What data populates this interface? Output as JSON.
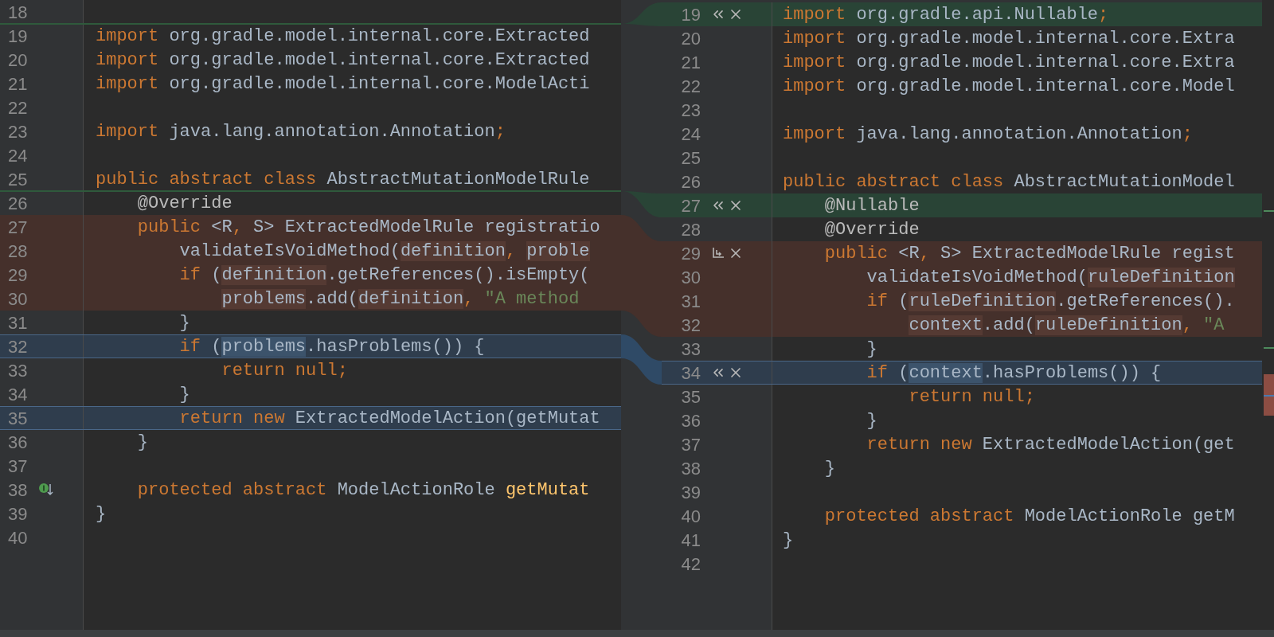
{
  "left": {
    "rows": [
      {
        "num": "18",
        "kind": "none"
      },
      {
        "num": "19",
        "kind": "none",
        "tokens": [
          {
            "text": "import",
            "kind": "kw"
          },
          {
            "text": " org.gradle.model.internal.core.Extracted",
            "kind": "plain"
          }
        ]
      },
      {
        "num": "20",
        "kind": "none",
        "tokens": [
          {
            "text": "import",
            "kind": "kw"
          },
          {
            "text": " org.gradle.model.internal.core.Extracted",
            "kind": "plain"
          }
        ]
      },
      {
        "num": "21",
        "kind": "none",
        "tokens": [
          {
            "text": "import",
            "kind": "kw"
          },
          {
            "text": " org.gradle.model.internal.core.ModelActi",
            "kind": "plain"
          }
        ]
      },
      {
        "num": "22",
        "kind": "none"
      },
      {
        "num": "23",
        "kind": "none",
        "tokens": [
          {
            "text": "import",
            "kind": "kw"
          },
          {
            "text": " java.lang.annotation.Annotation",
            "kind": "plain"
          },
          {
            "text": ";",
            "kind": "kw"
          }
        ]
      },
      {
        "num": "24",
        "kind": "none"
      },
      {
        "num": "25",
        "kind": "none",
        "tokens": [
          {
            "text": "public abstract class",
            "kind": "kw"
          },
          {
            "text": " AbstractMutationModelRule",
            "kind": "plain"
          }
        ]
      },
      {
        "num": "26",
        "kind": "none",
        "tokens": [
          {
            "text": "    @Override",
            "kind": "ann"
          }
        ]
      },
      {
        "num": "27",
        "kind": "removed",
        "tokens": [
          {
            "text": "    public",
            "kind": "kw"
          },
          {
            "text": " <R",
            "kind": "plain"
          },
          {
            "text": ",",
            "kind": "kw"
          },
          {
            "text": " S> ExtractedModelRule registratio",
            "kind": "plain"
          }
        ]
      },
      {
        "num": "28",
        "kind": "removed",
        "tokens": [
          {
            "text": "        validateIsVoidMethod(",
            "kind": "plain"
          },
          {
            "text": "definition",
            "kind": "plain",
            "hl": true
          },
          {
            "text": ", ",
            "kind": "kw"
          },
          {
            "text": "proble",
            "kind": "plain",
            "hl": true
          }
        ]
      },
      {
        "num": "29",
        "kind": "removed",
        "tokens": [
          {
            "text": "        if",
            "kind": "kw"
          },
          {
            "text": " (",
            "kind": "plain"
          },
          {
            "text": "definition",
            "kind": "plain",
            "hl": true
          },
          {
            "text": ".getReferences().isEmpty(",
            "kind": "plain"
          }
        ]
      },
      {
        "num": "30",
        "kind": "removed",
        "tokens": [
          {
            "text": "            problems",
            "kind": "plain",
            "hl": true
          },
          {
            "text": ".add(",
            "kind": "plain"
          },
          {
            "text": "definition",
            "kind": "plain",
            "hl": true
          },
          {
            "text": ",",
            "kind": "kw"
          },
          {
            "text": " \"A method",
            "kind": "str"
          }
        ]
      },
      {
        "num": "31",
        "kind": "none",
        "tokens": [
          {
            "text": "        }",
            "kind": "plain"
          }
        ]
      },
      {
        "num": "32",
        "kind": "modified",
        "tokens": [
          {
            "text": "        if",
            "kind": "kw"
          },
          {
            "text": " (",
            "kind": "plain"
          },
          {
            "text": "problems",
            "kind": "plain",
            "hl": true
          },
          {
            "text": ".hasProblems()) {",
            "kind": "plain"
          }
        ]
      },
      {
        "num": "33",
        "kind": "none",
        "tokens": [
          {
            "text": "            return null;",
            "kind": "kw"
          }
        ]
      },
      {
        "num": "34",
        "kind": "none",
        "tokens": [
          {
            "text": "        }",
            "kind": "plain"
          }
        ]
      },
      {
        "num": "35",
        "kind": "modified",
        "tokens": [
          {
            "text": "        return new",
            "kind": "kw"
          },
          {
            "text": " ExtractedModelAction(getMutat",
            "kind": "plain"
          }
        ]
      },
      {
        "num": "36",
        "kind": "none",
        "tokens": [
          {
            "text": "    }",
            "kind": "plain"
          }
        ]
      },
      {
        "num": "37",
        "kind": "none"
      },
      {
        "num": "38",
        "kind": "none",
        "gutter_icon": {
          "kind": "implemented"
        },
        "tokens": [
          {
            "text": "    protected abstract",
            "kind": "kw"
          },
          {
            "text": " ModelActionRole ",
            "kind": "plain"
          },
          {
            "text": "getMutat",
            "kind": "fn"
          }
        ]
      },
      {
        "num": "39",
        "kind": "none",
        "tokens": [
          {
            "text": "}",
            "kind": "plain"
          }
        ]
      },
      {
        "num": "40",
        "kind": "none"
      }
    ]
  },
  "right": {
    "rows": [
      {
        "num": "19",
        "kind": "inserted",
        "actions": [
          {
            "kind": "accept"
          },
          {
            "kind": "discard"
          }
        ],
        "tokens": [
          {
            "text": "import",
            "kind": "kw"
          },
          {
            "text": " org.gradle.api.Nullable",
            "kind": "plain"
          },
          {
            "text": ";",
            "kind": "kw"
          }
        ]
      },
      {
        "num": "20",
        "kind": "none",
        "tokens": [
          {
            "text": "import",
            "kind": "kw"
          },
          {
            "text": " org.gradle.model.internal.core.Extra",
            "kind": "plain"
          }
        ]
      },
      {
        "num": "21",
        "kind": "none",
        "tokens": [
          {
            "text": "import",
            "kind": "kw"
          },
          {
            "text": " org.gradle.model.internal.core.Extra",
            "kind": "plain"
          }
        ]
      },
      {
        "num": "22",
        "kind": "none",
        "tokens": [
          {
            "text": "import",
            "kind": "kw"
          },
          {
            "text": " org.gradle.model.internal.core.Model",
            "kind": "plain"
          }
        ]
      },
      {
        "num": "23",
        "kind": "none"
      },
      {
        "num": "24",
        "kind": "none",
        "tokens": [
          {
            "text": "import",
            "kind": "kw"
          },
          {
            "text": " java.lang.annotation.Annotation",
            "kind": "plain"
          },
          {
            "text": ";",
            "kind": "kw"
          }
        ]
      },
      {
        "num": "25",
        "kind": "none"
      },
      {
        "num": "26",
        "kind": "none",
        "tokens": [
          {
            "text": "public abstract class",
            "kind": "kw"
          },
          {
            "text": " AbstractMutationModel",
            "kind": "plain"
          }
        ]
      },
      {
        "num": "27",
        "kind": "inserted",
        "actions": [
          {
            "kind": "accept"
          },
          {
            "kind": "discard"
          }
        ],
        "tokens": [
          {
            "text": "    @Nullable",
            "kind": "ann"
          }
        ]
      },
      {
        "num": "28",
        "kind": "none",
        "tokens": [
          {
            "text": "    @Override",
            "kind": "ann"
          }
        ]
      },
      {
        "num": "29",
        "kind": "removed",
        "actions": [
          {
            "kind": "append"
          },
          {
            "kind": "discard"
          }
        ],
        "tokens": [
          {
            "text": "    public",
            "kind": "kw"
          },
          {
            "text": " <R",
            "kind": "plain"
          },
          {
            "text": ",",
            "kind": "kw"
          },
          {
            "text": " S> ExtractedModelRule regist",
            "kind": "plain"
          }
        ]
      },
      {
        "num": "30",
        "kind": "removed",
        "tokens": [
          {
            "text": "        validateIsVoidMethod(",
            "kind": "plain"
          },
          {
            "text": "ruleDefinition",
            "kind": "plain",
            "hl": true
          }
        ]
      },
      {
        "num": "31",
        "kind": "removed",
        "tokens": [
          {
            "text": "        if",
            "kind": "kw"
          },
          {
            "text": " (",
            "kind": "plain"
          },
          {
            "text": "ruleDefinition",
            "kind": "plain",
            "hl": true
          },
          {
            "text": ".getReferences().",
            "kind": "plain"
          }
        ]
      },
      {
        "num": "32",
        "kind": "removed",
        "tokens": [
          {
            "text": "            context",
            "kind": "plain",
            "hl": true
          },
          {
            "text": ".add(",
            "kind": "plain"
          },
          {
            "text": "ruleDefinition",
            "kind": "plain",
            "hl": true
          },
          {
            "text": ",",
            "kind": "kw"
          },
          {
            "text": " \"A",
            "kind": "str"
          }
        ]
      },
      {
        "num": "33",
        "kind": "none",
        "tokens": [
          {
            "text": "        }",
            "kind": "plain"
          }
        ]
      },
      {
        "num": "34",
        "kind": "modified",
        "actions": [
          {
            "kind": "accept"
          },
          {
            "kind": "discard"
          }
        ],
        "tokens": [
          {
            "text": "        if",
            "kind": "kw"
          },
          {
            "text": " (",
            "kind": "plain"
          },
          {
            "text": "context",
            "kind": "plain",
            "hl": true
          },
          {
            "text": ".hasProblems()) {",
            "kind": "plain"
          }
        ]
      },
      {
        "num": "35",
        "kind": "none",
        "tokens": [
          {
            "text": "            return null;",
            "kind": "kw"
          }
        ]
      },
      {
        "num": "36",
        "kind": "none",
        "tokens": [
          {
            "text": "        }",
            "kind": "plain"
          }
        ]
      },
      {
        "num": "37",
        "kind": "none",
        "tokens": [
          {
            "text": "        return new",
            "kind": "kw"
          },
          {
            "text": " ExtractedModelAction(get",
            "kind": "plain"
          }
        ]
      },
      {
        "num": "38",
        "kind": "none",
        "tokens": [
          {
            "text": "    }",
            "kind": "plain"
          }
        ]
      },
      {
        "num": "39",
        "kind": "none"
      },
      {
        "num": "40",
        "kind": "none",
        "tokens": [
          {
            "text": "    protected abstract",
            "kind": "kw"
          },
          {
            "text": " ModelActionRole getM",
            "kind": "plain"
          }
        ]
      },
      {
        "num": "41",
        "kind": "none",
        "tokens": [
          {
            "text": "}",
            "kind": "plain"
          }
        ]
      },
      {
        "num": "42",
        "kind": "none"
      }
    ]
  }
}
